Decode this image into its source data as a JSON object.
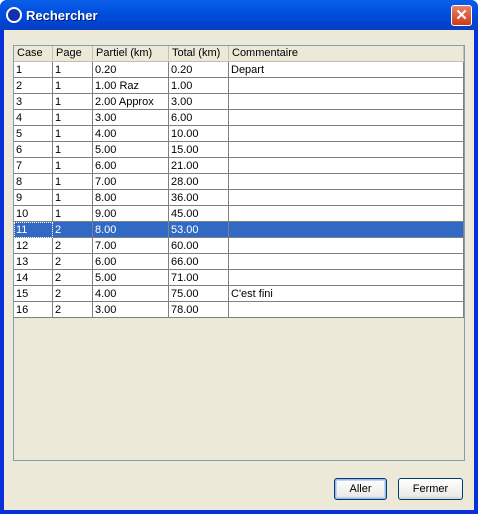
{
  "window": {
    "title": "Rechercher",
    "close_label": "✕"
  },
  "table": {
    "columns": [
      "Case",
      "Page",
      "Partiel (km)",
      "Total (km)",
      "Commentaire"
    ],
    "rows": [
      [
        "1",
        "1",
        "0.20",
        "0.20",
        "Depart"
      ],
      [
        "2",
        "1",
        "1.00 Raz",
        "1.00",
        ""
      ],
      [
        "3",
        "1",
        "2.00 Approx",
        "3.00",
        ""
      ],
      [
        "4",
        "1",
        "3.00",
        "6.00",
        ""
      ],
      [
        "5",
        "1",
        "4.00",
        "10.00",
        ""
      ],
      [
        "6",
        "1",
        "5.00",
        "15.00",
        ""
      ],
      [
        "7",
        "1",
        "6.00",
        "21.00",
        ""
      ],
      [
        "8",
        "1",
        "7.00",
        "28.00",
        ""
      ],
      [
        "9",
        "1",
        "8.00",
        "36.00",
        ""
      ],
      [
        "10",
        "1",
        "9.00",
        "45.00",
        ""
      ],
      [
        "11",
        "2",
        "8.00",
        "53.00",
        ""
      ],
      [
        "12",
        "2",
        "7.00",
        "60.00",
        ""
      ],
      [
        "13",
        "2",
        "6.00",
        "66.00",
        ""
      ],
      [
        "14",
        "2",
        "5.00",
        "71.00",
        ""
      ],
      [
        "15",
        "2",
        "4.00",
        "75.00",
        "C'est fini"
      ],
      [
        "16",
        "2",
        "3.00",
        "78.00",
        ""
      ]
    ],
    "selected_row": 10
  },
  "buttons": {
    "go": "Aller",
    "close": "Fermer"
  }
}
